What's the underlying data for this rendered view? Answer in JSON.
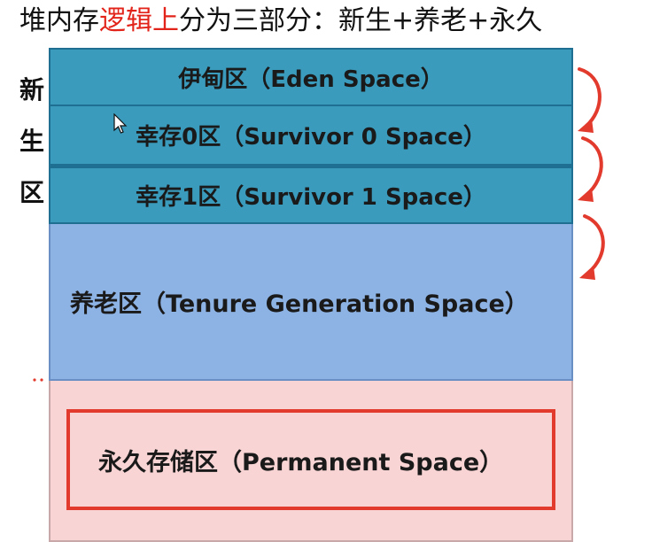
{
  "title": {
    "part1": "堆内存",
    "highlight": "逻辑上",
    "part2": "分为三部分：新生+养老+永久"
  },
  "young_gen_label": [
    "新",
    "生",
    "区"
  ],
  "regions": {
    "eden": "伊甸区（Eden Space）",
    "survivor0": "幸存0区（Survivor 0 Space）",
    "survivor1": "幸存1区（Survivor 1 Space）",
    "tenure": "养老区（Tenure Generation Space）",
    "permanent": "永久存储区（Permanent Space）"
  },
  "colors": {
    "young": "#3a9bbd",
    "tenure": "#8db2e4",
    "permanent": "#f8d4d4",
    "highlight": "#e2231a",
    "arrow": "#e23b2e"
  }
}
